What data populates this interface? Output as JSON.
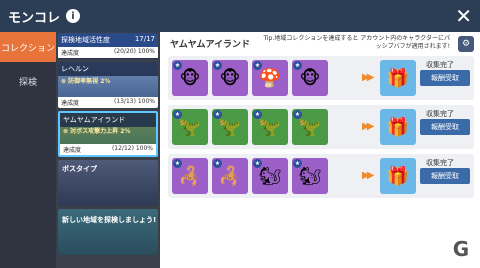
{
  "header": {
    "title": "モンコレ",
    "info_glyph": "i",
    "close_glyph": "✕"
  },
  "nav": {
    "items": [
      {
        "label": "コレクション",
        "active": true
      },
      {
        "label": "探検",
        "active": false
      }
    ]
  },
  "regions": [
    {
      "label": "探検地域活性度",
      "progress": "17/17"
    },
    {
      "label": "レヘルン",
      "bonus": "防御率無視 2%",
      "stat_label": "達成度",
      "stat_value": "(13/13) 100%"
    },
    {
      "label": "ヤムヤムアイランド",
      "bonus": "対ボス攻撃力上昇 2%",
      "stat_label": "達成度",
      "stat_value": "(12/12) 100%"
    },
    {
      "label": "ボスタイプ"
    },
    {
      "label": "新しい地域を探検しましょう!"
    }
  ],
  "region_top_stat": {
    "label": "達成度",
    "value": "(20/20) 100%"
  },
  "main": {
    "region_title": "ヤムヤムアイランド",
    "tip": "Tip.地域コレクションを達成すると アカウント内のキャラクターにパッシブバフが適用されます!",
    "sets": [
      {
        "monsters": [
          "🐵",
          "🐵",
          "🍄",
          "🐵"
        ],
        "status": "収集完了",
        "button": "報酬受取"
      },
      {
        "monsters": [
          "🦖",
          "🦖",
          "🦖",
          "🦖"
        ],
        "status": "収集完了",
        "button": "報酬受取"
      },
      {
        "monsters": [
          "🦂",
          "🦂",
          "🐿",
          "🐿"
        ],
        "status": "収集完了",
        "button": "報酬受取"
      }
    ]
  },
  "colors": {
    "header": "#2c3e55",
    "active_nav": "#e8743b",
    "button": "#3a6aa8"
  }
}
